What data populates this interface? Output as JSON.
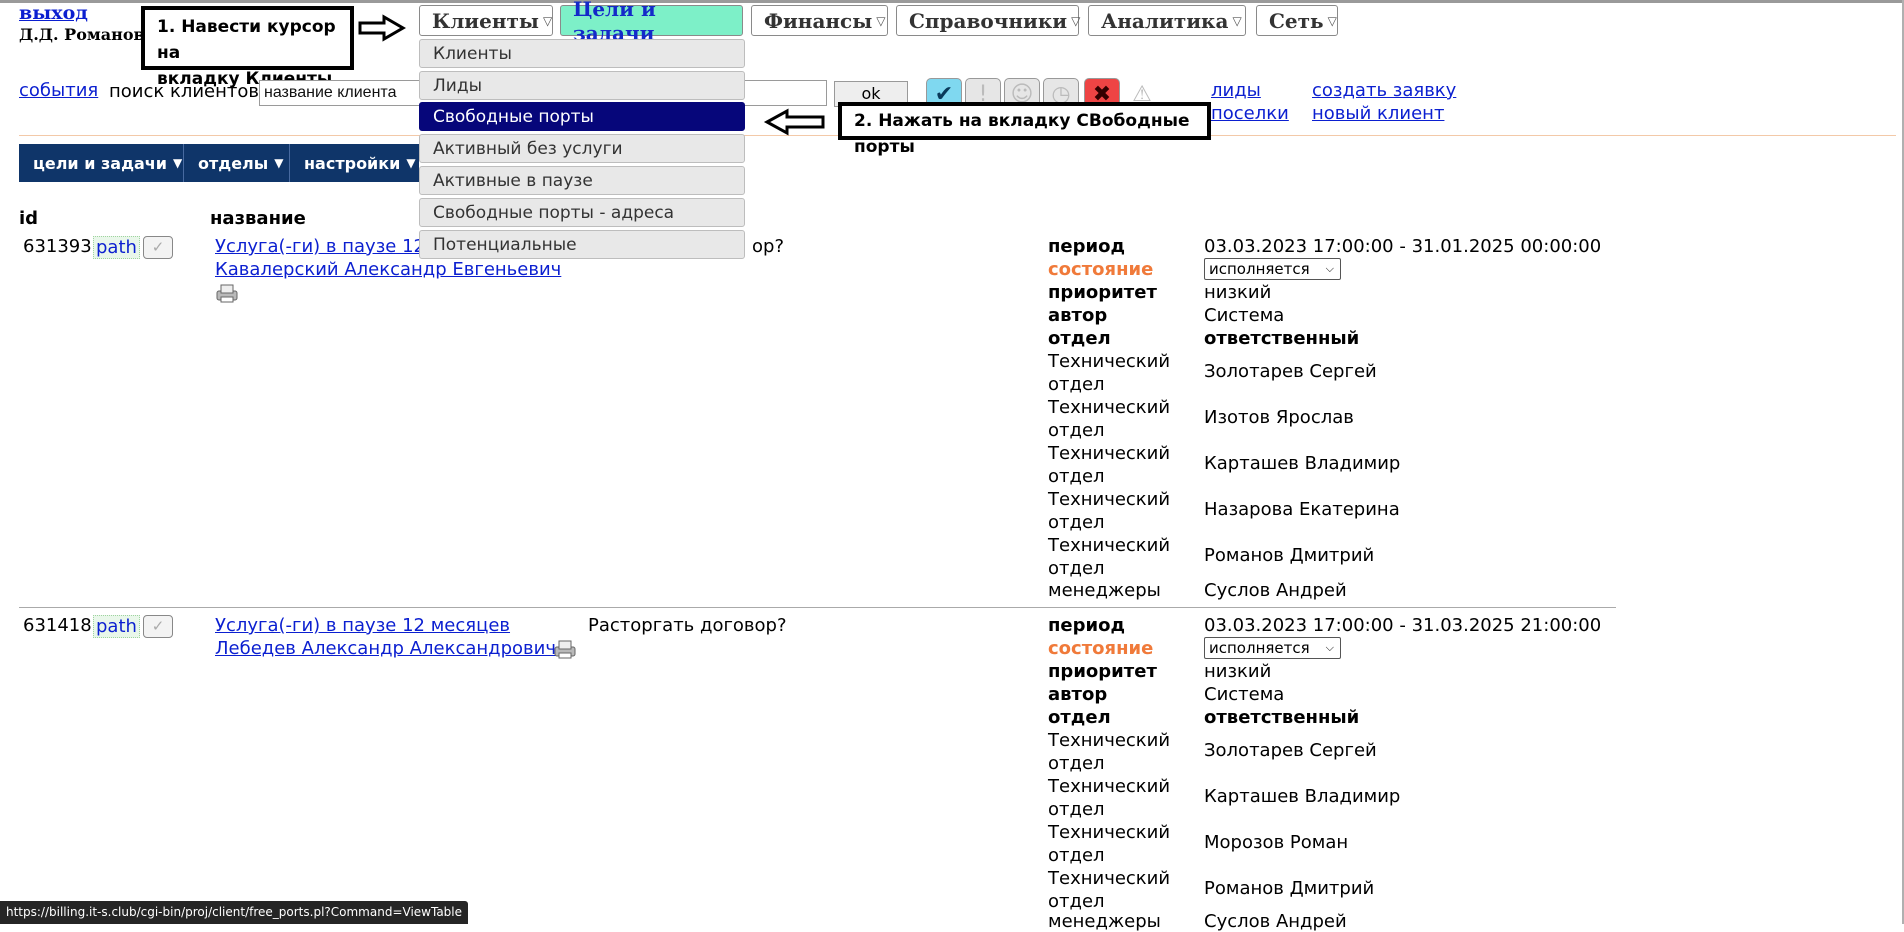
{
  "header": {
    "logout": "выход",
    "user": "Д.Д. Романов"
  },
  "annotations": {
    "note1": [
      "1. Навести курсор на",
      "вкладку Клиенты"
    ],
    "note2": "2. Нажать на вкладку СВободные порты"
  },
  "nav": {
    "tabs": [
      "Клиенты",
      "Цели и задачи",
      "Финансы",
      "Справочники",
      "Аналитика",
      "Сеть"
    ],
    "active": "Цели и задачи"
  },
  "dropdown": {
    "items": [
      "Клиенты",
      "Лиды",
      "Свободные порты",
      "Активный без услуги",
      "Активные в паузе",
      "Свободные порты - адреса",
      "Потенциальные"
    ],
    "selected": "Свободные порты"
  },
  "search": {
    "events_link": "события",
    "label": "поиск клиентов",
    "placeholder": "название клиента",
    "ok": "ok"
  },
  "quick_links": {
    "leads": "лиды",
    "villages": "поселки",
    "create_request": "создать заявку",
    "new_client": "новый клиент"
  },
  "subnav": [
    "цели и задачи",
    "отделы",
    "настройки"
  ],
  "table": {
    "headers": {
      "id": "id",
      "name": "название"
    },
    "labels": {
      "period": "период",
      "state": "состояние",
      "priority": "приоритет",
      "author": "автор",
      "dept": "отдел",
      "responsible": "ответственный",
      "tech_dept": [
        "Технический",
        "отдел"
      ],
      "managers": "менеджеры"
    },
    "rows": [
      {
        "id": "631393",
        "path": "path",
        "service": "Услуга(-ги) в паузе 12",
        "client": "Кавалерский Александр Евгеньевич",
        "question_tail": "ор?",
        "period": "03.03.2023 17:00:00 - 31.01.2025 00:00:00",
        "state": "исполняется",
        "priority": "низкий",
        "author": "Система",
        "responsible": [
          "Золотарев Сергей",
          "Изотов Ярослав",
          "Карташев Владимир",
          "Назарова Екатерина",
          "Романов Дмитрий"
        ],
        "manager": "Суслов Андрей"
      },
      {
        "id": "631418",
        "path": "path",
        "service": "Услуга(-ги) в паузе 12 месяцев",
        "client": "Лебедев Александр Александрович",
        "question": "Расторгать договор?",
        "period": "03.03.2023 17:00:00 - 31.03.2025 21:00:00",
        "state": "исполняется",
        "priority": "низкий",
        "author": "Система",
        "responsible": [
          "Золотарев Сергей",
          "Карташев Владимир",
          "Морозов Роман",
          "Романов Дмитрий"
        ],
        "manager_partial": "Суслов Андрей"
      }
    ]
  },
  "statusbar": "https://billing.it-s.club/cgi-bin/proj/client/free_ports.pl?Command=ViewTable",
  "colors": {
    "nav_dark": "#0f3569",
    "tab_active_bg": "#7df0c8",
    "menu_selected": "#06067a",
    "state_label": "#f07a3a",
    "link": "#0b1fd0"
  }
}
